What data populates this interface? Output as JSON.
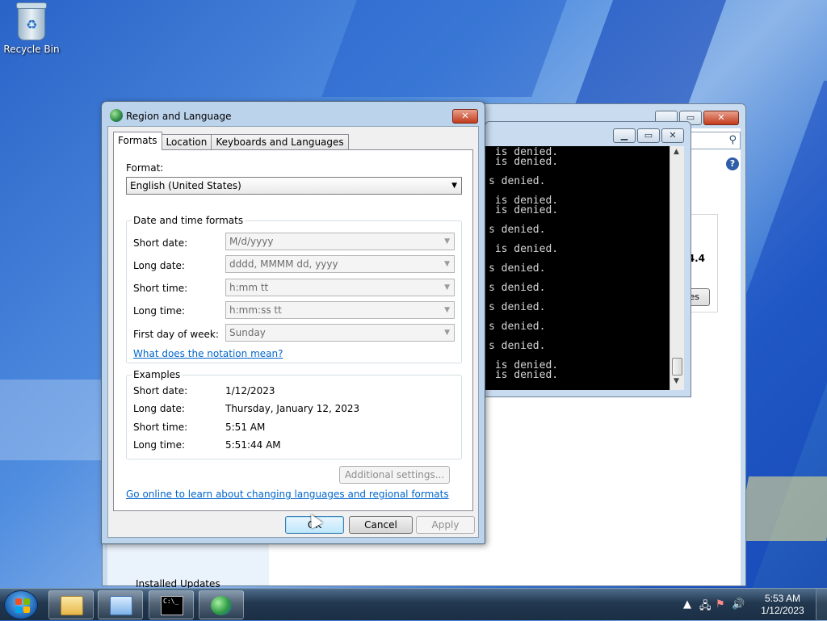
{
  "desktop": {
    "icons": [
      {
        "label": "Recycle Bin",
        "icon": "recycle-bin-icon"
      }
    ]
  },
  "back_window": {
    "left_pane_item": "Installed Updates",
    "partial_version": "4.4",
    "partial_button": "es"
  },
  "cmd": {
    "lines": [
      " is denied.",
      " is denied.",
      "",
      "s denied.",
      "",
      " is denied.",
      " is denied.",
      "",
      "s denied.",
      "",
      " is denied.",
      "",
      "s denied.",
      "",
      "s denied.",
      "",
      "s denied.",
      "",
      "s denied.",
      "",
      "s denied.",
      "",
      " is denied.",
      " is denied."
    ]
  },
  "dialog": {
    "title": "Region and Language",
    "tabs": [
      "Formats",
      "Location",
      "Keyboards and Languages"
    ],
    "format_label": "Format:",
    "format_value": "English (United States)",
    "date_time_group": "Date and time formats",
    "fields": [
      {
        "label": "Short date:",
        "value": "M/d/yyyy"
      },
      {
        "label": "Long date:",
        "value": "dddd, MMMM dd, yyyy"
      },
      {
        "label": "Short time:",
        "value": "h:mm tt"
      },
      {
        "label": "Long time:",
        "value": "h:mm:ss tt"
      },
      {
        "label": "First day of week:",
        "value": "Sunday"
      }
    ],
    "notation_link": "What does the notation mean?",
    "examples_group": "Examples",
    "examples": [
      {
        "label": "Short date:",
        "value": "1/12/2023"
      },
      {
        "label": "Long date:",
        "value": "Thursday, January 12, 2023"
      },
      {
        "label": "Short time:",
        "value": "5:51 AM"
      },
      {
        "label": "Long time:",
        "value": "5:51:44 AM"
      }
    ],
    "additional_settings": "Additional settings...",
    "online_link": "Go online to learn about changing languages and regional formats",
    "ok": "OK",
    "cancel": "Cancel",
    "apply": "Apply"
  },
  "taskbar": {
    "time": "5:53 AM",
    "date": "1/12/2023"
  },
  "colors": {
    "link": "#0066cc",
    "accent": "#3c7fb1"
  }
}
